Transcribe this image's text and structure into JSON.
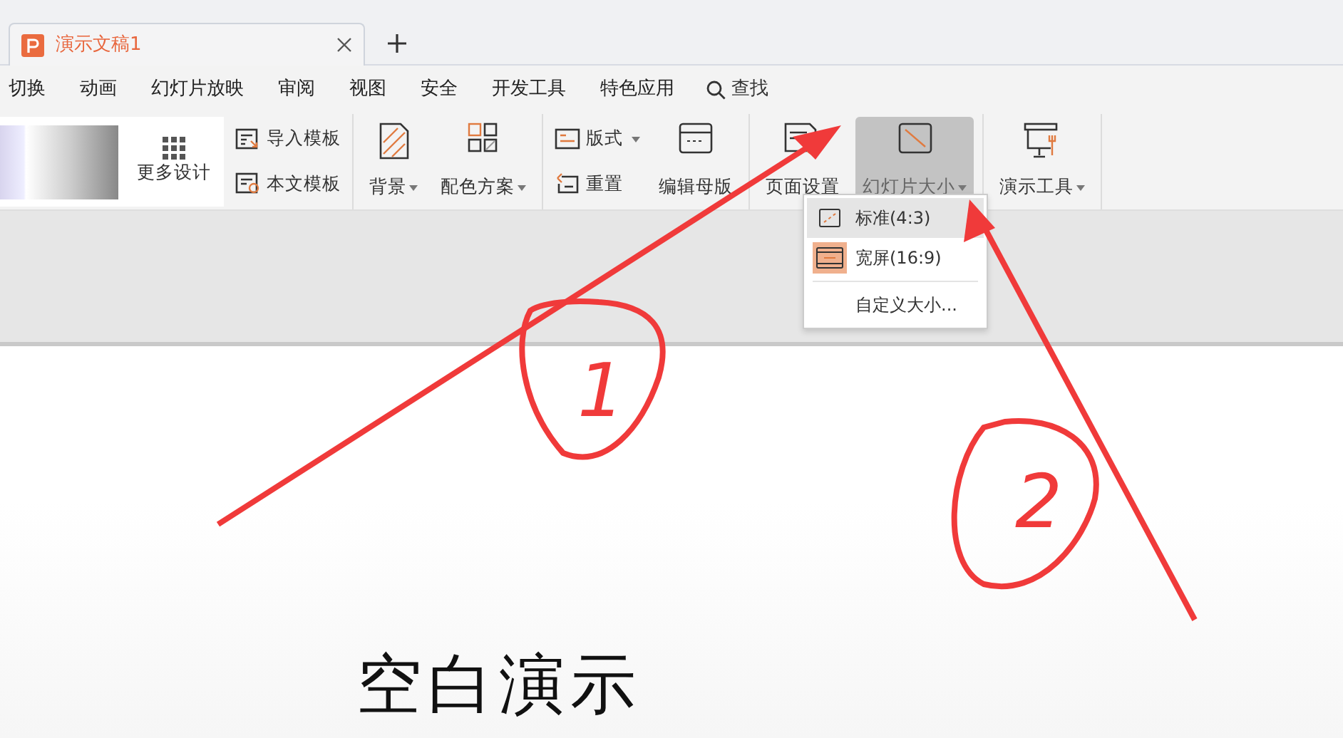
{
  "document_tab": {
    "title": "演示文稿1",
    "selected": true
  },
  "menu_tabs": [
    {
      "label": "切换"
    },
    {
      "label": "动画"
    },
    {
      "label": "幻灯片放映"
    },
    {
      "label": "审阅"
    },
    {
      "label": "视图"
    },
    {
      "label": "安全"
    },
    {
      "label": "开发工具"
    },
    {
      "label": "特色应用"
    }
  ],
  "search": {
    "label": "查找"
  },
  "ribbon_groups": [
    [
      {
        "kind": "design",
        "label": "更多设计"
      },
      {
        "kind": "stack",
        "items": [
          {
            "label": "导入模板",
            "has_menu": false
          },
          {
            "label": "本文模板",
            "has_menu": false
          }
        ]
      }
    ],
    [
      {
        "kind": "large",
        "label": "背景",
        "has_menu": true,
        "active": false
      },
      {
        "kind": "large",
        "label": "配色方案",
        "has_menu": true,
        "active": false
      }
    ],
    [
      {
        "kind": "stack",
        "items": [
          {
            "label": "版式",
            "has_menu": true
          },
          {
            "label": "重置",
            "has_menu": false
          }
        ]
      },
      {
        "kind": "large",
        "label": "编辑母版",
        "has_menu": false,
        "active": false
      }
    ],
    [
      {
        "kind": "large",
        "label": "页面设置",
        "has_menu": false,
        "active": false
      },
      {
        "kind": "large",
        "label": "幻灯片大小",
        "has_menu": true,
        "active": true
      }
    ],
    [
      {
        "kind": "large",
        "label": "演示工具",
        "has_menu": true,
        "active": false
      }
    ]
  ],
  "size_menu": [
    {
      "kind": "standard",
      "label": "标准(4:3)",
      "hovered": true,
      "selected": false
    },
    {
      "kind": "wide",
      "label": "宽屏(16:9)",
      "hovered": false,
      "selected": true
    },
    {
      "kind": "custom",
      "label": "自定义大小...",
      "hovered": false,
      "selected": false
    }
  ],
  "slide": {
    "title": "空白演示"
  },
  "annotations": [
    {
      "label": "1"
    },
    {
      "label": "2"
    }
  ]
}
